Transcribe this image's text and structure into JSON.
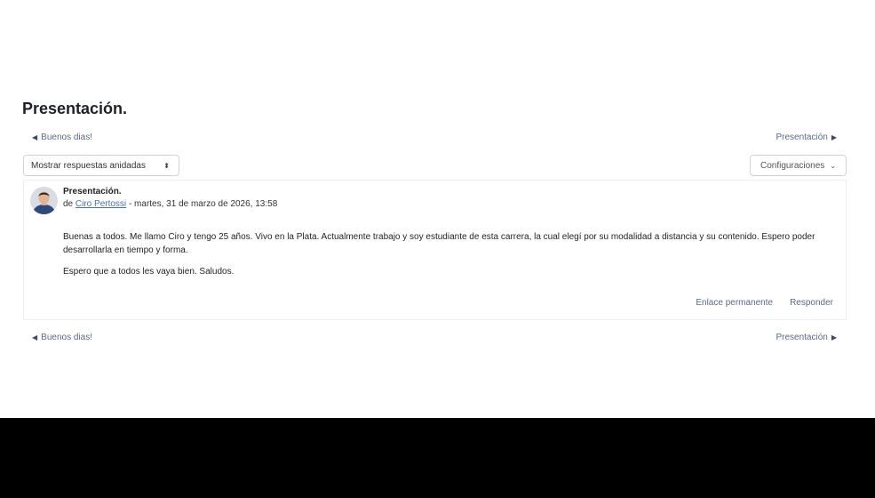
{
  "discussion": {
    "title": "Presentación."
  },
  "nav": {
    "prev_label": "Buenos dias!",
    "next_label": "Presentación",
    "prev_icon": "triangle-left-icon",
    "next_icon": "triangle-right-icon"
  },
  "controls": {
    "display_mode_value": "Mostrar respuestas anidadas",
    "display_mode_icon": "sort-arrows-icon",
    "settings_label": "Configuraciones",
    "settings_icon": "chevron-down-icon"
  },
  "post": {
    "subject": "Presentación.",
    "by_prefix": "de",
    "author": "Ciro Pertossi",
    "date": "- martes, 31 de marzo de 2026, 13:58",
    "body_p1": "Buenas a todos. Me llamo Ciro y tengo 25 años. Vivo en la Plata. Actualmente trabajo y soy estudiante de esta carrera, la cual elegí por su modalidad a distancia y su contenido. Espero poder desarrollarla en tiempo y forma.",
    "body_p2": "Espero que a todos les vaya bien. Saludos.",
    "permalink_label": "Enlace permanente",
    "reply_label": "Responder"
  },
  "colors": {
    "link": "#5a6a8a",
    "author_link": "#4a6fa5",
    "title": "#1d2125",
    "border": "#ced4da"
  }
}
